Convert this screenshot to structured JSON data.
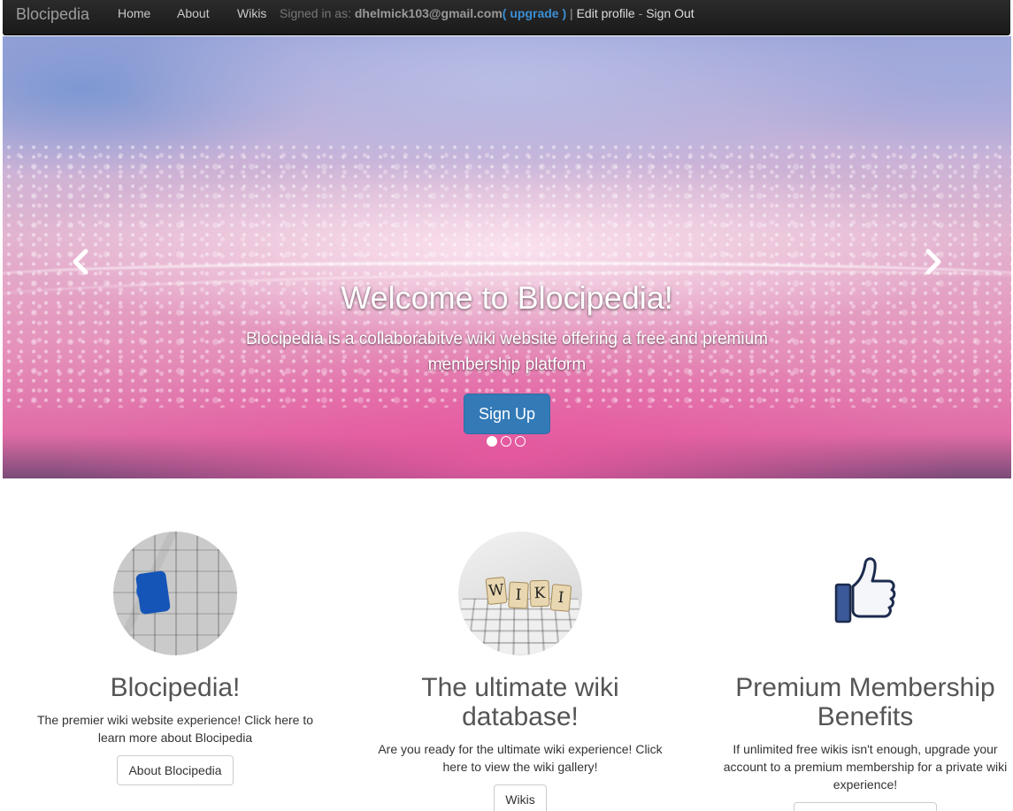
{
  "navbar": {
    "brand": "Blocipedia",
    "links": [
      "Home",
      "About",
      "Wikis"
    ],
    "signed_in_prefix": "Signed in as: ",
    "email": "dhelmick103@gmail.com",
    "upgrade_open": "( ",
    "upgrade": "upgrade",
    "upgrade_close": " )",
    "sep1": " | ",
    "edit_profile": "Edit profile",
    "sep2": " - ",
    "sign_out": "Sign Out"
  },
  "carousel": {
    "title": "Welcome to Blocipedia!",
    "text": "Blocipedia is a collaborabitve wiki website offering a free and premium membership platform",
    "button": "Sign Up",
    "prev_icon": "chevron-left-icon",
    "next_icon": "chevron-right-icon",
    "slides": 3,
    "active_slide": 1
  },
  "features": [
    {
      "image": "puzzle-image",
      "title": "Blocipedia!",
      "text": "The premier wiki website experience! Click here to learn more about Blocipedia",
      "button": "About Blocipedia"
    },
    {
      "image": "wiki-keyboard-image",
      "title": "The ultimate wiki database!",
      "text": "Are you ready for the ultimate wiki experience! Click here to view the wiki gallery!",
      "button": "Wikis",
      "blocks": [
        "W",
        "I",
        "K",
        "I"
      ]
    },
    {
      "image": "thumbs-up-icon",
      "title": "Premium Membership Benefits",
      "text": "If unlimited free wikis isn't enough, upgrade your account to a premium membership for a private wiki experience!"
    }
  ],
  "colors": {
    "navbar_bg": "#222222",
    "primary": "#337ab7",
    "upgrade_link": "#3a8fd6"
  }
}
